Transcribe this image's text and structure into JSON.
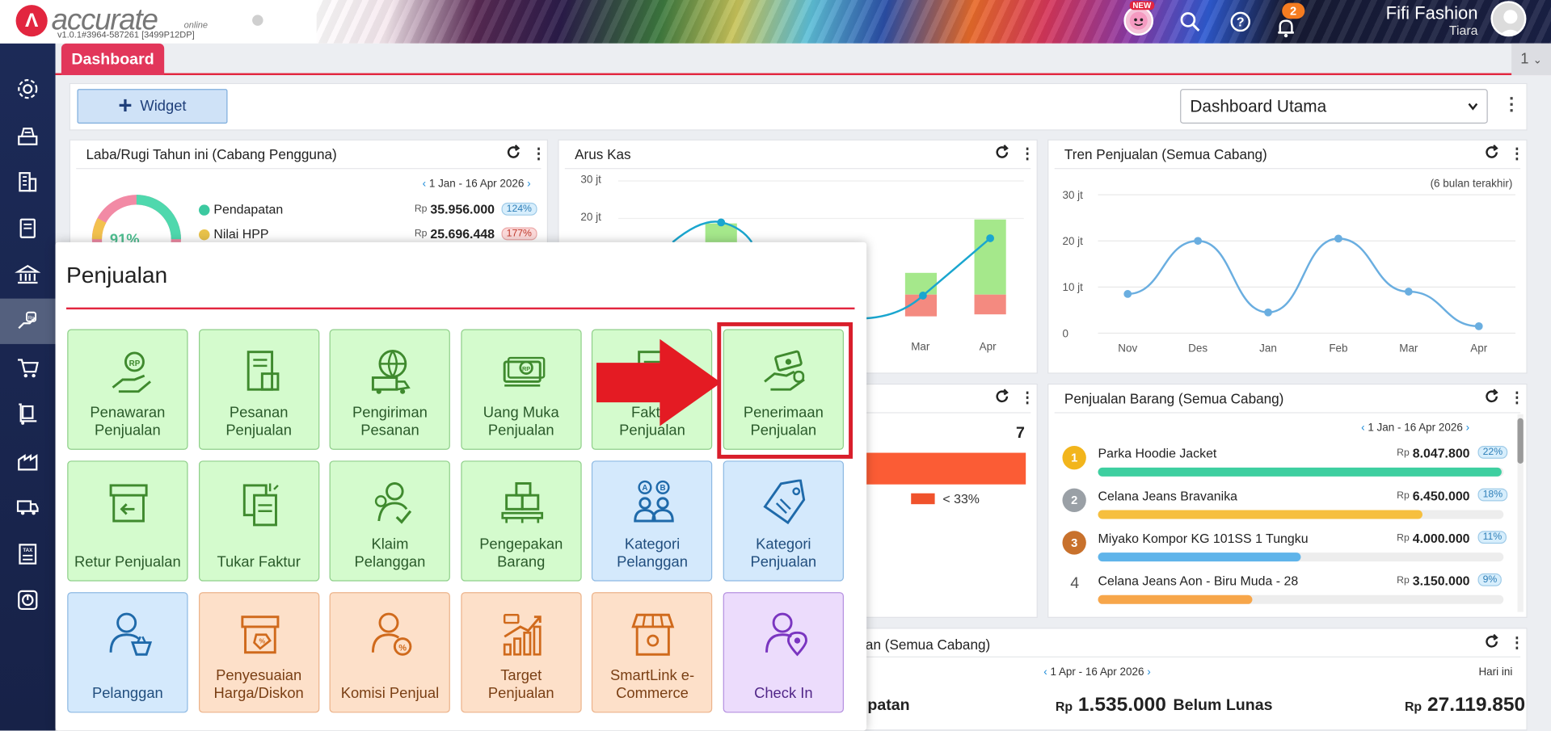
{
  "topbar": {
    "logo_text": "accurate",
    "logo_sub": "online",
    "version": "v1.0.1#3964-587261 [3499P12DP]",
    "new_badge": "NEW",
    "notif_count": "2",
    "company": "Fifi Fashion",
    "user": "Tiara"
  },
  "tabs": {
    "dashboard": "Dashboard",
    "counter": "1"
  },
  "toolbar": {
    "widget_label": "Widget",
    "dashboard_select": "Dashboard Utama"
  },
  "laba": {
    "title": "Laba/Rugi Tahun ini (Cabang Pengguna)",
    "date_range": "1 Jan - 16 Apr 2026",
    "gauge": "91%",
    "rows": [
      {
        "label": "Pendapatan",
        "currency": "Rp",
        "value": "35.956.000",
        "pct": "124%",
        "color": "#3cc9a0"
      },
      {
        "label": "Nilai HPP",
        "currency": "Rp",
        "value": "25.696.448",
        "pct": "177%",
        "color": "#e8c24a"
      }
    ]
  },
  "arus": {
    "title": "Arus Kas",
    "y_ticks": [
      "30 jt",
      "20 jt"
    ],
    "x_ticks": [
      "Mar",
      "Apr"
    ]
  },
  "tren": {
    "title": "Tren Penjualan (Semua Cabang)",
    "note": "(6 bulan terakhir)",
    "y_ticks": [
      "30 jt",
      "20 jt",
      "10 jt",
      "0"
    ],
    "x_ticks": [
      "Nov",
      "Des",
      "Jan",
      "Feb",
      "Mar",
      "Apr"
    ]
  },
  "chart_data": {
    "type": "line",
    "categories": [
      "Nov",
      "Des",
      "Jan",
      "Feb",
      "Mar",
      "Apr"
    ],
    "values": [
      8.5,
      20,
      4.5,
      20.5,
      9,
      1.5
    ],
    "title": "Tren Penjualan (Semua Cabang)",
    "ylabel": "",
    "ylim": [
      0,
      30
    ],
    "grid": true,
    "color": "#6aaee0"
  },
  "mid_panel": {
    "count": "7",
    "legend": "< 33%"
  },
  "barang": {
    "title": "Penjualan Barang (Semua Cabang)",
    "date_range": "1 Jan - 16 Apr 2026",
    "items": [
      {
        "rank": "1",
        "name": "Parka Hoodie Jacket",
        "currency": "Rp",
        "value": "8.047.800",
        "pct": "22%",
        "fill": 0.995,
        "color": "#3ecfa0"
      },
      {
        "rank": "2",
        "name": "Celana Jeans Bravanika",
        "currency": "Rp",
        "value": "6.450.000",
        "pct": "18%",
        "fill": 0.8,
        "color": "#f6bf3e"
      },
      {
        "rank": "3",
        "name": "Miyako Kompor KG 101SS 1 Tungku",
        "currency": "Rp",
        "value": "4.000.000",
        "pct": "11%",
        "fill": 0.5,
        "color": "#5fb4ea"
      },
      {
        "rank": "4",
        "name": "Celana Jeans Aon - Biru Muda - 28",
        "currency": "Rp",
        "value": "3.150.000",
        "pct": "9%",
        "fill": 0.38,
        "color": "#f7a64a"
      }
    ]
  },
  "piutang": {
    "title_partial": "an (Semua Cabang)",
    "date_range": "1 Apr - 16 Apr 2026",
    "period": "Hari ini",
    "left_label": "patan",
    "left_currency": "Rp",
    "left_value": "1.535.000",
    "right_label": "Belum Lunas",
    "right_currency": "Rp",
    "right_value": "27.119.850"
  },
  "penjualan_menu": {
    "title": "Penjualan",
    "tiles": [
      {
        "label": "Penawaran Penjualan",
        "color": "green",
        "icon": "hand-coin-icon"
      },
      {
        "label": "Pesanan Penjualan",
        "color": "green",
        "icon": "document-box-icon"
      },
      {
        "label": "Pengiriman Pesanan",
        "color": "green",
        "icon": "globe-truck-icon"
      },
      {
        "label": "Uang Muka Penjualan",
        "color": "green",
        "icon": "money-stack-icon"
      },
      {
        "label": "Faktur Penjualan",
        "color": "green",
        "icon": "invoice-icon"
      },
      {
        "label": "Penerimaan Penjualan",
        "color": "green",
        "icon": "hand-cash-icon"
      },
      {
        "label": "Retur Penjualan",
        "color": "green",
        "icon": "return-box-icon"
      },
      {
        "label": "Tukar Faktur",
        "color": "green",
        "icon": "exchange-doc-icon"
      },
      {
        "label": "Klaim Pelanggan",
        "color": "green",
        "icon": "user-check-icon"
      },
      {
        "label": "Pengepakan Barang",
        "color": "green",
        "icon": "boxes-pallet-icon"
      },
      {
        "label": "Kategori Pelanggan",
        "color": "blue",
        "icon": "user-group-ab-icon"
      },
      {
        "label": "Kategori Penjualan",
        "color": "blue",
        "icon": "tag-icon"
      },
      {
        "label": "Pelanggan",
        "color": "blue",
        "icon": "user-basket-icon"
      },
      {
        "label": "Penyesuaian Harga/Diskon",
        "color": "orange",
        "icon": "box-discount-icon"
      },
      {
        "label": "Komisi Penjual",
        "color": "orange",
        "icon": "user-percent-icon"
      },
      {
        "label": "Target Penjualan",
        "color": "orange",
        "icon": "growth-chart-icon"
      },
      {
        "label": "SmartLink e-Commerce",
        "color": "orange",
        "icon": "storefront-icon"
      },
      {
        "label": "Check In",
        "color": "purple",
        "icon": "user-location-icon"
      }
    ]
  }
}
